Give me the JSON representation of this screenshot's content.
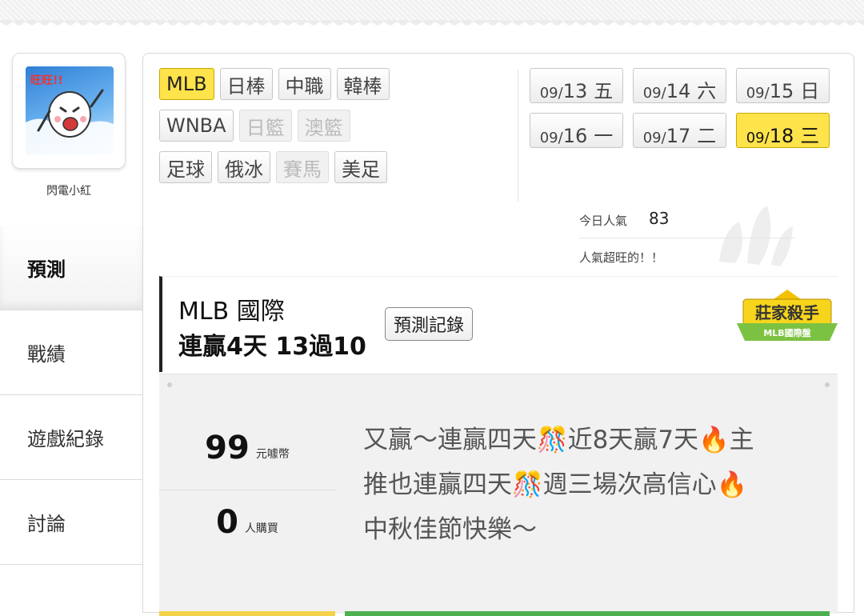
{
  "user": {
    "name": "閃電小紅",
    "avatar_text": "旺旺!!"
  },
  "nav": {
    "items": [
      {
        "label": "預測",
        "active": true
      },
      {
        "label": "戰績",
        "active": false
      },
      {
        "label": "遊戲紀錄",
        "active": false
      },
      {
        "label": "討論",
        "active": false
      }
    ]
  },
  "sports": {
    "row1": [
      {
        "label": "MLB",
        "state": "active"
      },
      {
        "label": "日棒",
        "state": "normal"
      },
      {
        "label": "中職",
        "state": "normal"
      },
      {
        "label": "韓棒",
        "state": "normal"
      }
    ],
    "row2": [
      {
        "label": "WNBA",
        "state": "normal"
      },
      {
        "label": "日籃",
        "state": "disabled"
      },
      {
        "label": "澳籃",
        "state": "disabled"
      }
    ],
    "row3": [
      {
        "label": "足球",
        "state": "normal"
      },
      {
        "label": "俄冰",
        "state": "normal"
      },
      {
        "label": "賽馬",
        "state": "disabled"
      },
      {
        "label": "美足",
        "state": "normal"
      }
    ]
  },
  "dates": [
    {
      "month": "09/",
      "day": "13",
      "weekday": "五",
      "active": false
    },
    {
      "month": "09/",
      "day": "14",
      "weekday": "六",
      "active": false
    },
    {
      "month": "09/",
      "day": "15",
      "weekday": "日",
      "active": false
    },
    {
      "month": "09/",
      "day": "16",
      "weekday": "一",
      "active": false
    },
    {
      "month": "09/",
      "day": "17",
      "weekday": "二",
      "active": false
    },
    {
      "month": "09/",
      "day": "18",
      "weekday": "三",
      "active": true
    }
  ],
  "popularity": {
    "label": "今日人氣",
    "count": "83",
    "note": "人氣超旺的！！"
  },
  "prediction": {
    "league": "MLB 國際",
    "streak": "連贏4天 13過10",
    "record_button": "預測記錄",
    "badge_title": "莊家殺手",
    "badge_sub": "MLB國際盤"
  },
  "purchase": {
    "price": "99",
    "price_unit": "元噱幣",
    "buyers": "0",
    "buyers_unit": "人購買"
  },
  "message": {
    "line1": "又贏～連贏四天🎊近8天贏7天🔥主",
    "line2": "推也連贏四天🎊週三場次高信心🔥",
    "line3": "中秋佳節快樂～"
  },
  "colors": {
    "accent_yellow": "#ffe34a",
    "green": "#4caf50"
  }
}
